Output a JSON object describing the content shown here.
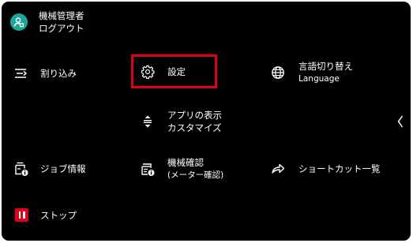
{
  "colors": {
    "background": "#000000",
    "avatar": "#1aa69a",
    "stop": "#e0001b",
    "highlight": "#e0001b",
    "text": "#ffffff"
  },
  "user": {
    "name": "機械管理者",
    "logout_label": "ログアウト",
    "icon": "user-avatar-icon"
  },
  "menu": {
    "interrupt": {
      "label": "割り込み",
      "icon": "interrupt-icon"
    },
    "settings": {
      "label": "設定",
      "icon": "gear-icon",
      "highlighted": true
    },
    "language": {
      "label": "言語切り替え",
      "sub_label": "Language",
      "icon": "globe-icon"
    },
    "app_display": {
      "label": "アプリの表示",
      "sub_label": "カスタマイズ",
      "icon": "reorder-icon"
    },
    "job_info": {
      "label": "ジョブ情報",
      "icon": "job-info-icon"
    },
    "machine_check": {
      "label": "機械確認",
      "sub_label": "(メーター確認)",
      "icon": "machine-check-icon"
    },
    "shortcut_list": {
      "label": "ショートカット一覧",
      "icon": "share-arrow-icon"
    },
    "stop": {
      "label": "ストップ",
      "icon": "stop-icon"
    }
  },
  "collapse": {
    "icon": "chevron-left-icon"
  }
}
